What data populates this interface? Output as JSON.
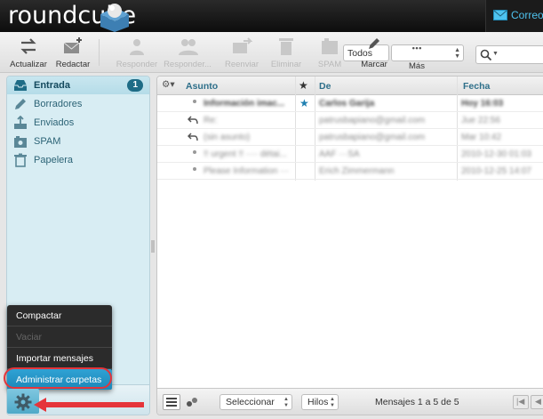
{
  "app": {
    "logo_text": "roundcube",
    "mail_tab_label": "Correo"
  },
  "toolbar": {
    "buttons": [
      {
        "id": "actualizar",
        "label": "Actualizar",
        "icon": "refresh-icon",
        "disabled": false
      },
      {
        "id": "redactar",
        "label": "Redactar",
        "icon": "compose-icon",
        "disabled": false
      },
      {
        "id": "responder",
        "label": "Responder",
        "icon": "reply-icon",
        "disabled": true
      },
      {
        "id": "responder_todos",
        "label": "Responder...",
        "icon": "reply-all-icon",
        "disabled": true
      },
      {
        "id": "reenviar",
        "label": "Reenviar",
        "icon": "forward-icon",
        "disabled": true
      },
      {
        "id": "eliminar",
        "label": "Eliminar",
        "icon": "trash-icon",
        "disabled": true
      },
      {
        "id": "spam",
        "label": "SPAM",
        "icon": "spam-icon",
        "disabled": true
      },
      {
        "id": "marcar",
        "label": "Marcar",
        "icon": "pencil-icon",
        "disabled": false
      },
      {
        "id": "mas",
        "label": "Más",
        "icon": "more-dots-icon",
        "disabled": false
      }
    ],
    "filter_value": "Todos"
  },
  "folders": [
    {
      "label": "Entrada",
      "icon": "inbox-icon",
      "badge": "1",
      "selected": true
    },
    {
      "label": "Borradores",
      "icon": "drafts-pencil-icon"
    },
    {
      "label": "Enviados",
      "icon": "sent-icon"
    },
    {
      "label": "SPAM",
      "icon": "spam-folder-icon"
    },
    {
      "label": "Papelera",
      "icon": "trash-folder-icon"
    }
  ],
  "message_list": {
    "columns": {
      "subject": "Asunto",
      "from": "De",
      "date": "Fecha"
    },
    "rows": [
      {
        "subject": "Información imac...",
        "from": "Carlos Garija",
        "date": "Hoy 16:03",
        "unread": true,
        "flagged": true,
        "replied": false
      },
      {
        "subject": "Re:",
        "from": "patrusbapiano@gmail.com",
        "date": "Jue 22:56",
        "unread": false,
        "flagged": false,
        "replied": true
      },
      {
        "subject": "(sin asunto)",
        "from": "patrusbapiano@gmail.com",
        "date": "Mar 10:42",
        "unread": false,
        "flagged": false,
        "replied": true
      },
      {
        "subject": "!! urgent !! ···· détai...",
        "from": "AAF ···SA",
        "date": "2010-12-30 01:03",
        "unread": false,
        "flagged": false,
        "replied": false
      },
      {
        "subject": "Please Information ···",
        "from": "Erich Zimmermann",
        "date": "2010-12-25 14:07",
        "unread": false,
        "flagged": false,
        "replied": false
      }
    ],
    "footer": {
      "select_label": "Seleccionar",
      "threads_label": "Hilos",
      "count_text": "Mensajes 1 a 5 de 5"
    }
  },
  "folder_menu": {
    "items": [
      {
        "label": "Compactar",
        "disabled": false
      },
      {
        "label": "Vaciar",
        "disabled": true
      },
      {
        "label": "Importar mensajes",
        "disabled": false
      },
      {
        "label": "Administrar carpetas",
        "disabled": false,
        "highlighted": true
      }
    ]
  },
  "colors": {
    "accent": "#2fa2d4",
    "panel": "#d8edf3",
    "highlight_ring": "#e5343a",
    "badge": "#1e6c86"
  }
}
